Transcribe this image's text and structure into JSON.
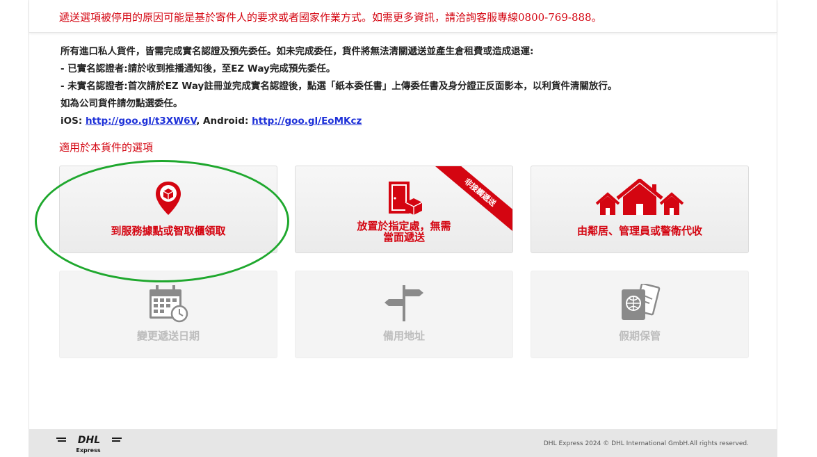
{
  "notice": "遞送選項被停用的原因可能是基於寄件人的要求或者國家作業方式。如需更多資訊，請洽詢客服專線0800-769-888。",
  "info": {
    "line1": "所有進口私人貨件，皆需完成實名認證及預先委任。如未完成委任，貨件將無法清關遞送並產生倉租費或造成退運:",
    "line2": "- 已實名認證者:請於收到推播通知後，至EZ Way完成預先委任。",
    "line3": "- 未實名認證者:首次請於EZ Way註冊並完成實名認證後，點選「紙本委任書」上傳委任書及身分證正反面影本，以利貨件清關放行。",
    "line4": "如為公司貨件請勿點選委任。",
    "ios_label": "iOS: ",
    "ios_link": "http://goo.gl/t3XW6V",
    "android_label": ", Android: ",
    "android_link": "http://goo.gl/EoMKcz"
  },
  "options_title": "適用於本貨件的選項",
  "options": {
    "service_point": {
      "label": "到服務據點或智取櫃領取",
      "icon": "location-pin-package-icon",
      "enabled": true
    },
    "leave_at": {
      "label1": "放置於指定處，無需",
      "label2": "當面遞送",
      "ribbon": "非接觸遞送",
      "icon": "door-package-icon",
      "enabled": true
    },
    "neighbor": {
      "label": "由鄰居、管理員或警衛代收",
      "icon": "houses-icon",
      "enabled": true
    },
    "change_date": {
      "label": "變更遞送日期",
      "icon": "calendar-clock-icon",
      "enabled": false
    },
    "alt_address": {
      "label": "備用地址",
      "icon": "signpost-icon",
      "enabled": false
    },
    "vacation_hold": {
      "label": "假期保管",
      "icon": "passport-icon",
      "enabled": false
    }
  },
  "footer": {
    "logo_text": "DHL",
    "logo_sub": "Express",
    "copyright": "DHL Express 2024 © DHL International GmbH.All rights reserved."
  },
  "colors": {
    "brand_red": "#d40511",
    "highlight_green": "#1fa82e",
    "link_blue": "#1d30d8"
  }
}
